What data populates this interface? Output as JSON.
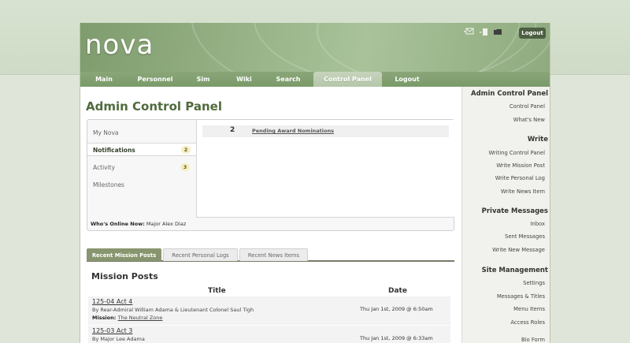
{
  "app": {
    "logo": "nova"
  },
  "header": {
    "icons": [
      "envelope-icon",
      "document-icon",
      "folder-icon"
    ],
    "logout_label": "Logout"
  },
  "nav": {
    "tabs": [
      {
        "label": "Main"
      },
      {
        "label": "Personnel"
      },
      {
        "label": "Sim"
      },
      {
        "label": "Wiki"
      },
      {
        "label": "Search"
      },
      {
        "label": "Control Panel",
        "active": true
      },
      {
        "label": "Logout"
      }
    ]
  },
  "main": {
    "title": "Admin Control Panel",
    "cp_menu": [
      {
        "label": "My Nova"
      },
      {
        "label": "Notifications",
        "badge": "2",
        "selected": true
      },
      {
        "label": "Activity",
        "badge": "3"
      },
      {
        "label": "Milestones"
      }
    ],
    "notification": {
      "count": "2",
      "label": "Pending Award Nominations"
    },
    "online": {
      "label": "Who's Online Now:",
      "value": "Major Alex Diaz"
    },
    "tabs": [
      {
        "label": "Recent Mission Posts",
        "active": true
      },
      {
        "label": "Recent Personal Logs"
      },
      {
        "label": "Recent News Items"
      }
    ],
    "section_title": "Mission Posts",
    "columns": {
      "title": "Title",
      "date": "Date"
    },
    "posts": [
      {
        "title": "125-04 Act 4",
        "by": "By Rear-Admiral William Adama & Lieutenant Colonel Saul Tigh",
        "mission_label": "Mission:",
        "mission": "The Neutral Zone",
        "date": "Thu Jan 1st, 2009 @ 6:50am"
      },
      {
        "title": "125-03 Act 3",
        "by": "By Major Lee Adama",
        "date": "Thu Jan 1st, 2009 @ 6:33am"
      }
    ]
  },
  "sidebar": {
    "sections": [
      {
        "title": "Admin Control Panel",
        "links": [
          "Control Panel",
          "What's New"
        ]
      },
      {
        "title": "Write",
        "links": [
          "Writing Control Panel",
          "Write Mission Post",
          "Write Personal Log",
          "Write News Item"
        ]
      },
      {
        "title": "Private Messages",
        "links": [
          "Inbox",
          "Sent Messages",
          "Write New Message"
        ]
      },
      {
        "title": "Site Management",
        "links": [
          "Settings",
          "Messages & Titles",
          "Menu Items",
          "Access Roles",
          "Bio Form"
        ]
      }
    ]
  },
  "colors": {
    "header_green": "#8faa7e",
    "title_green": "#4f6b3d",
    "tab_active": "#88966f",
    "badge_bg": "#f5efc4"
  }
}
